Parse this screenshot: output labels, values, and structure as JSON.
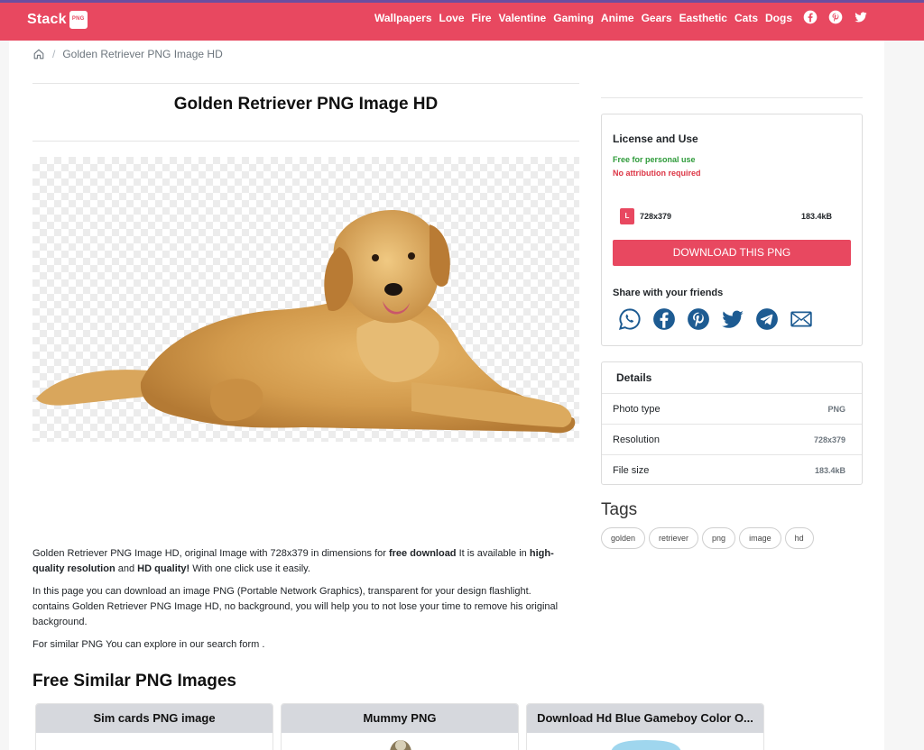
{
  "header": {
    "logo_text": "Stack",
    "logo_badge": "PNG",
    "nav": [
      "Wallpapers",
      "Love",
      "Fire",
      "Valentine",
      "Gaming",
      "Anime",
      "Gears",
      "Easthetic",
      "Cats",
      "Dogs"
    ],
    "social_icons": [
      "facebook-icon",
      "pinterest-icon",
      "twitter-icon"
    ],
    "colors": {
      "brand": "#e84860",
      "top_border": "#6b4ea0"
    }
  },
  "breadcrumb": {
    "home_icon": "home-icon",
    "current": "Golden Retriever PNG Image HD"
  },
  "page": {
    "title": "Golden Retriever PNG Image HD"
  },
  "description": {
    "p1_start": "Golden Retriever PNG Image HD, original Image with 728x379 in dimensions for ",
    "p1_bold1": "free download",
    "p1_mid": " It is available in ",
    "p1_bold2": "high-quality resolution",
    "p1_and": " and ",
    "p1_bold3": "HD quality!",
    "p1_end": " With one click use it easily.",
    "p2": "In this page you can download an image PNG (Portable Network Graphics), transparent for your design flashlight. contains Golden Retriever PNG Image HD, no background, you will help you to not lose your time to remove his original background.",
    "p3": "For similar PNG You can explore in our search form ."
  },
  "similar": {
    "title": "Free Similar PNG Images",
    "items": [
      "Sim cards PNG image",
      "Mummy PNG",
      "Download Hd Blue Gameboy Color O..."
    ]
  },
  "license": {
    "title": "License and Use",
    "free": "Free for personal use",
    "no_attribution": "No attribution required",
    "badge": "L",
    "resolution": "728x379",
    "size": "183.4kB",
    "download_label": "DOWNLOAD THIS PNG",
    "share_title": "Share with your friends",
    "share_icons": [
      "whatsapp-icon",
      "facebook-icon",
      "pinterest-icon",
      "twitter-icon",
      "telegram-icon",
      "email-icon"
    ]
  },
  "details": {
    "title": "Details",
    "rows": [
      {
        "label": "Photo type",
        "value": "PNG"
      },
      {
        "label": "Resolution",
        "value": "728x379"
      },
      {
        "label": "File size",
        "value": "183.4kB"
      }
    ]
  },
  "tags": {
    "title": "Tags",
    "items": [
      "golden",
      "retriever",
      "png",
      "image",
      "hd"
    ]
  }
}
